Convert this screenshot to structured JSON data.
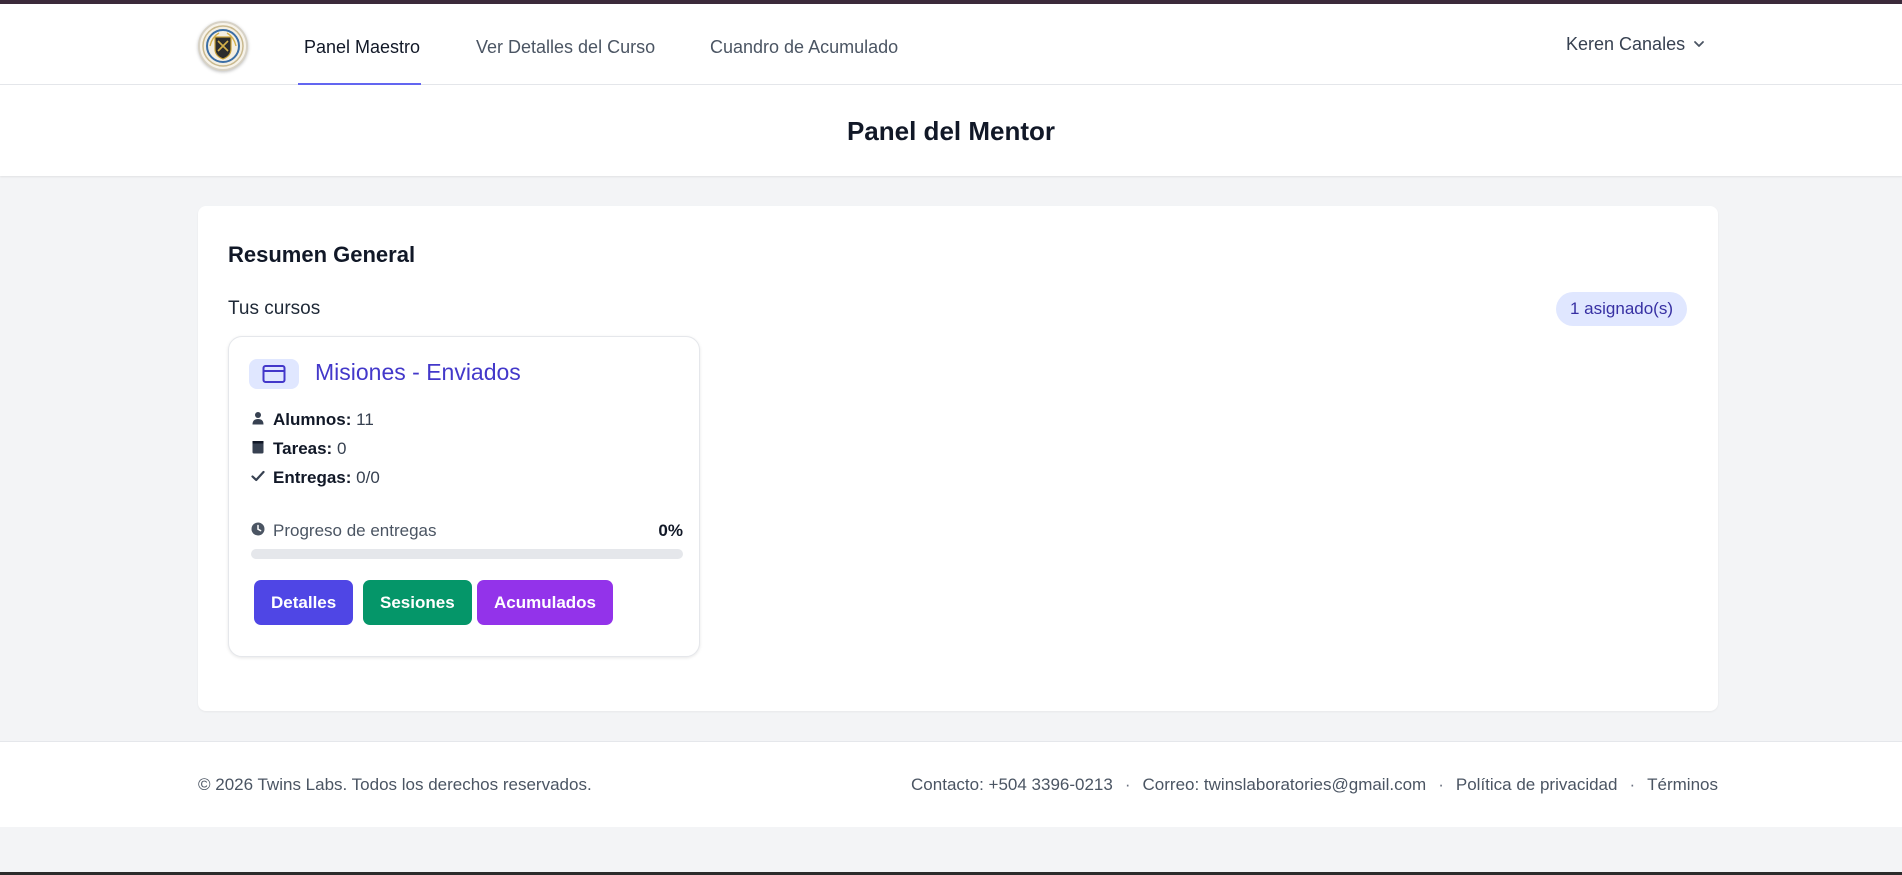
{
  "nav": {
    "links": [
      {
        "label": "Panel Maestro",
        "active": true
      },
      {
        "label": "Ver Detalles del Curso",
        "active": false
      },
      {
        "label": "Cuandro de Acumulado",
        "active": false
      }
    ],
    "user_name": "Keren Canales"
  },
  "header": {
    "title": "Panel del Mentor"
  },
  "summary": {
    "title": "Resumen General",
    "courses_label": "Tus cursos",
    "assigned_badge": "1 asignado(s)"
  },
  "course": {
    "title": "Misiones - Enviados",
    "students_label": "Alumnos:",
    "students_value": "11",
    "tasks_label": "Tareas:",
    "tasks_value": "0",
    "submissions_label": "Entregas:",
    "submissions_value": "0/0",
    "progress_label": "Progreso de entregas",
    "progress_text": "0%",
    "progress_value": 0,
    "buttons": {
      "details": "Detalles",
      "sessions": "Sesiones",
      "accumulated": "Acumulados"
    }
  },
  "footer": {
    "copyright": "© 2026 Twins Labs. Todos los derechos reservados.",
    "contact": "Contacto: +504 3396-0213",
    "email": "Correo: twinslaboratories@gmail.com",
    "privacy": "Política de privacidad",
    "terms": "Términos",
    "separator": "·"
  },
  "colors": {
    "accent": "#6366f1",
    "details_button": "#4f46e5",
    "sessions_button": "#059669",
    "accumulated_button": "#9333ea"
  },
  "icons": {
    "logo": "school-crest-logo",
    "user_chevron": "chevron-down-icon",
    "course": "credit-card-icon",
    "students": "user-icon",
    "tasks": "calendar-icon",
    "submissions": "check-icon",
    "progress": "clock-icon"
  }
}
